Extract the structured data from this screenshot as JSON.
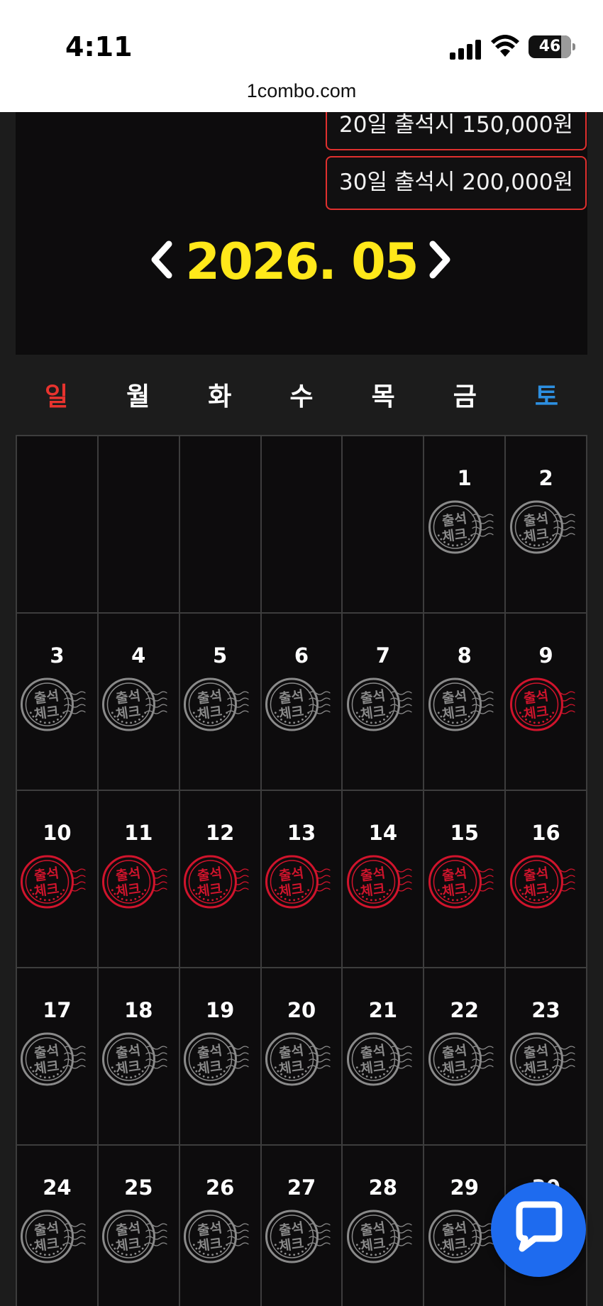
{
  "status_bar": {
    "time": "4:11",
    "battery": "46"
  },
  "browser": {
    "url": "1combo.com"
  },
  "rewards": [
    {
      "label": "20일 출석시 150,000원"
    },
    {
      "label": "30일 출석시 200,000원"
    }
  ],
  "calendar": {
    "title": "2026. 05",
    "weekdays": [
      "일",
      "월",
      "화",
      "수",
      "목",
      "금",
      "토"
    ],
    "leading_blank_cells": 5,
    "days": [
      {
        "day": "1",
        "checked": false
      },
      {
        "day": "2",
        "checked": false
      },
      {
        "day": "3",
        "checked": false
      },
      {
        "day": "4",
        "checked": false
      },
      {
        "day": "5",
        "checked": false
      },
      {
        "day": "6",
        "checked": false
      },
      {
        "day": "7",
        "checked": false
      },
      {
        "day": "8",
        "checked": false
      },
      {
        "day": "9",
        "checked": true
      },
      {
        "day": "10",
        "checked": true
      },
      {
        "day": "11",
        "checked": true
      },
      {
        "day": "12",
        "checked": true
      },
      {
        "day": "13",
        "checked": true
      },
      {
        "day": "14",
        "checked": true
      },
      {
        "day": "15",
        "checked": true
      },
      {
        "day": "16",
        "checked": true
      },
      {
        "day": "17",
        "checked": false
      },
      {
        "day": "18",
        "checked": false
      },
      {
        "day": "19",
        "checked": false
      },
      {
        "day": "20",
        "checked": false
      },
      {
        "day": "21",
        "checked": false
      },
      {
        "day": "22",
        "checked": false
      },
      {
        "day": "23",
        "checked": false
      },
      {
        "day": "24",
        "checked": false
      },
      {
        "day": "25",
        "checked": false
      },
      {
        "day": "26",
        "checked": false
      },
      {
        "day": "27",
        "checked": false
      },
      {
        "day": "28",
        "checked": false
      },
      {
        "day": "29",
        "checked": false
      },
      {
        "day": "30",
        "checked": false
      }
    ],
    "stamp_text_top": "출석",
    "stamp_text_bottom": "체크",
    "colors": {
      "stamp_checked": "#d0142c",
      "stamp_unchecked": "#8a8a8a",
      "title": "#ffe81a",
      "sunday": "#e8332e",
      "saturday": "#2d8fe0"
    }
  },
  "icons": {
    "prev": "chevron-left-icon",
    "next": "chevron-right-icon",
    "chat": "chat-bubble-icon"
  }
}
